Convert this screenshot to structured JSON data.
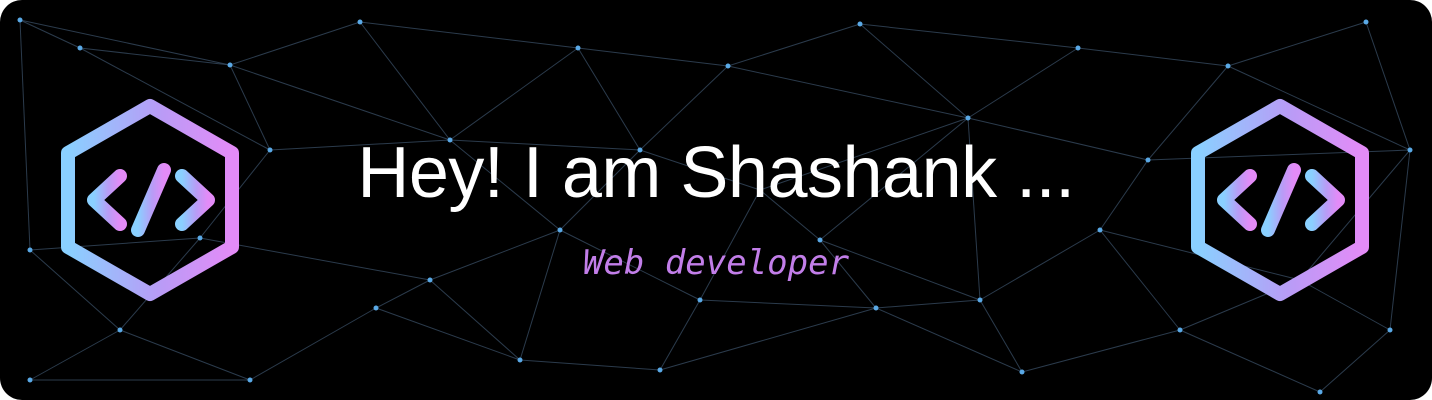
{
  "banner": {
    "headline": "Hey! I am Shashank ...",
    "subtitle": "Web developer"
  },
  "logos": [
    {
      "icon": "code-hexagon-icon"
    },
    {
      "icon": "code-hexagon-icon"
    }
  ],
  "colors": {
    "background": "#000000",
    "mesh_line": "#3a4f66",
    "mesh_node": "#5aa9e6",
    "headline": "#ffffff",
    "subtitle": "#c27ee9",
    "logo_gradient_start": "#8ad0ff",
    "logo_gradient_mid": "#b89cf6",
    "logo_gradient_end": "#e38bf7"
  }
}
